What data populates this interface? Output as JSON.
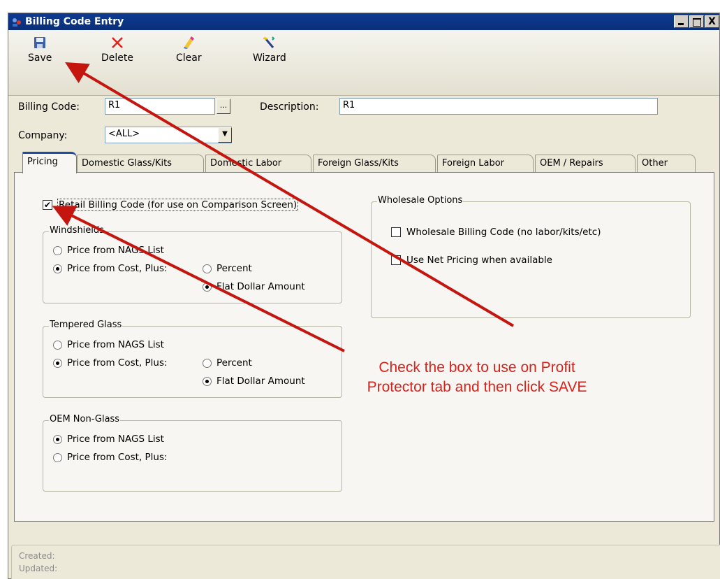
{
  "window": {
    "title": "Billing Code Entry",
    "close_glyph": "X"
  },
  "toolbar": {
    "save_label": "Save",
    "delete_label": "Delete",
    "clear_label": "Clear",
    "wizard_label": "Wizard"
  },
  "form": {
    "billing_code_label": "Billing Code:",
    "billing_code_value": "R1",
    "browse_label": "...",
    "description_label": "Description:",
    "description_value": "R1",
    "company_label": "Company:",
    "company_value": "<ALL>",
    "dropdown_glyph": "▼"
  },
  "tabs": [
    {
      "label": "Pricing"
    },
    {
      "label": "Domestic Glass/Kits"
    },
    {
      "label": "Domestic Labor"
    },
    {
      "label": "Foreign Glass/Kits"
    },
    {
      "label": "Foreign Labor"
    },
    {
      "label": "OEM / Repairs"
    },
    {
      "label": "Other"
    }
  ],
  "pricing": {
    "retail_checkbox_label": "Retail Billing Code (for use on Comparison Screen)",
    "retail_checked_glyph": "✔",
    "windshields": {
      "title": "Windshields",
      "nags": "Price from NAGS List",
      "cost": "Price from Cost, Plus:",
      "percent": "Percent",
      "flat": "Flat Dollar Amount"
    },
    "tempered": {
      "title": "Tempered Glass",
      "nags": "Price from NAGS List",
      "cost": "Price from Cost, Plus:",
      "percent": "Percent",
      "flat": "Flat Dollar Amount"
    },
    "oem": {
      "title": "OEM Non-Glass",
      "nags": "Price from NAGS List",
      "cost": "Price from Cost, Plus:"
    },
    "wholesale": {
      "title": "Wholesale Options",
      "billing_code": "Wholesale Billing Code (no labor/kits/etc)",
      "net_pricing": "Use Net Pricing when available"
    }
  },
  "status": {
    "created": "Created:",
    "updated": "Updated:"
  },
  "annotation": {
    "line1": "Check the box to use on Profit",
    "line2": "Protector tab and then click SAVE",
    "color": "#d8221c"
  }
}
